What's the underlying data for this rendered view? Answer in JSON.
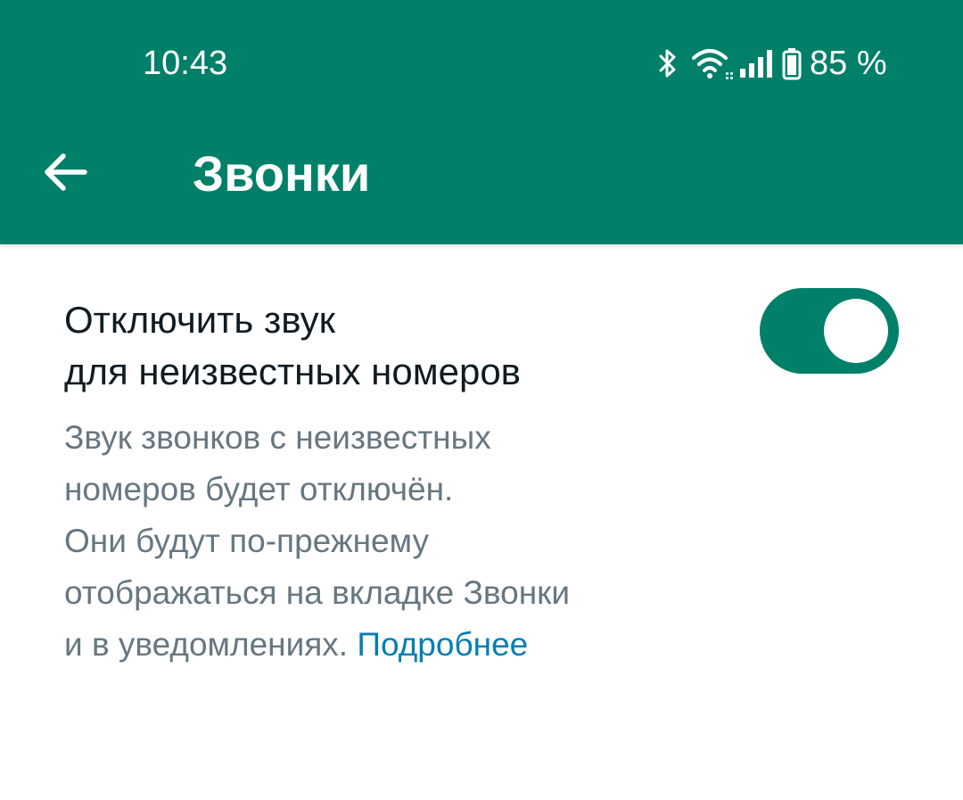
{
  "status_bar": {
    "time": "10:43",
    "battery_percent": "85 %",
    "icons": [
      "bluetooth-icon",
      "wifi-icon",
      "signal-icon",
      "battery-icon"
    ]
  },
  "header": {
    "back_icon": "arrow-left-icon",
    "title": "Звонки"
  },
  "setting": {
    "title_lines": [
      "Отключить звук",
      "для неизвестных номеров"
    ],
    "description_lines": [
      "Звук звонков с неизвестных",
      "номеров будет отключён.",
      "Они будут по-прежнему",
      "отображаться на вкладке Звонки",
      "и в уведомлениях. "
    ],
    "link_label": "Подробнее",
    "toggle_on": true
  },
  "colors": {
    "header_bg": "#008069",
    "toggle_track": "#008069",
    "link": "#027eb5",
    "primary_text": "#111b21",
    "secondary_text": "#667781"
  }
}
